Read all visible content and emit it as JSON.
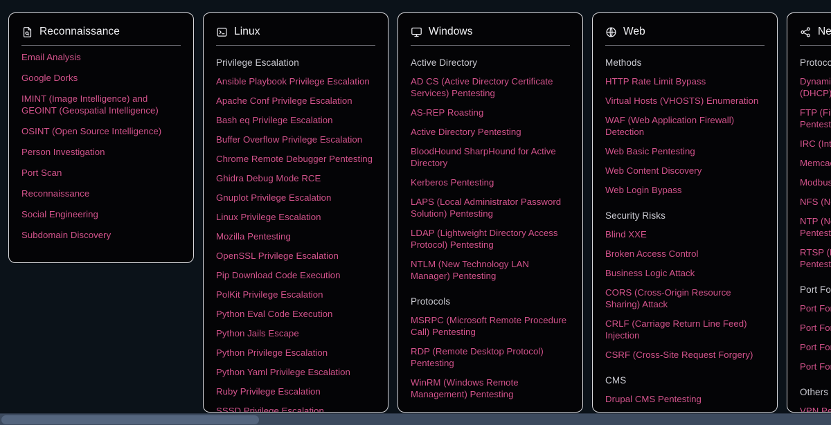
{
  "page": {
    "background_color": "#0b1219",
    "card_background_color": "#040406",
    "card_border_color": "#d8d8dc",
    "link_color": "#d3538c",
    "section_title_color": "#c9c9d0",
    "scrollbar_track_color": "#3c4a5e",
    "scrollbar_thumb_color": "#54657e"
  },
  "cards": [
    {
      "title": "Reconnaissance",
      "icon": "file-search-icon",
      "sections": [
        {
          "title": "",
          "links": [
            "Email Analysis",
            "Google Dorks",
            "IMINT (Image Intelligence) and GEOINT (Geospatial Intelligence)",
            "OSINT (Open Source Intelligence)",
            "Person Investigation",
            "Port Scan",
            "Reconnaissance",
            "Social Engineering",
            "Subdomain Discovery"
          ]
        }
      ]
    },
    {
      "title": "Linux",
      "icon": "square-terminal-icon",
      "sections": [
        {
          "title": "Privilege Escalation",
          "links": [
            "Ansible Playbook Privilege Escalation",
            "Apache Conf Privilege Escalation",
            "Bash eq Privilege Escalation",
            "Buffer Overflow Privilege Escalation",
            "Chrome Remote Debugger Pentesting",
            "Ghidra Debug Mode RCE",
            "Gnuplot Privilege Escalation",
            "Linux Privilege Escalation",
            "Mozilla Pentesting",
            "OpenSSL Privilege Escalation",
            "Pip Download Code Execution",
            "PolKit Privilege Escalation",
            "Python Eval Code Execution",
            "Python Jails Escape",
            "Python Privilege Escalation",
            "Python Yaml Privilege Escalation",
            "Ruby Privilege Escalation",
            "SSSD Privilege Escalation"
          ]
        }
      ]
    },
    {
      "title": "Windows",
      "icon": "monitor-icon",
      "sections": [
        {
          "title": "Active Directory",
          "links": [
            "AD CS (Active Directory Certificate Services) Pentesting",
            "AS-REP Roasting",
            "Active Directory Pentesting",
            "BloodHound SharpHound for Active Directory",
            "Kerberos Pentesting",
            "LAPS (Local Administrator Password Solution) Pentesting",
            "LDAP (Lightweight Directory Access Protocol) Pentesting",
            "NTLM (New Technology LAN Manager) Pentesting"
          ]
        },
        {
          "title": "Protocols",
          "links": [
            "MSRPC (Microsoft Remote Procedure Call) Pentesting",
            "RDP (Remote Desktop Protocol) Pentesting",
            "WinRM (Windows Remote Management) Pentesting"
          ]
        }
      ]
    },
    {
      "title": "Web",
      "icon": "globe-icon",
      "sections": [
        {
          "title": "Methods",
          "links": [
            "HTTP Rate Limit Bypass",
            "Virtual Hosts (VHOSTS) Enumeration",
            "WAF (Web Application Firewall) Detection",
            "Web Basic Pentesting",
            "Web Content Discovery",
            "Web Login Bypass"
          ]
        },
        {
          "title": "Security Risks",
          "links": [
            "Blind XXE",
            "Broken Access Control",
            "Business Logic Attack",
            "CORS (Cross-Origin Resource Sharing) Attack",
            "CRLF (Carriage Return Line Feed) Injection",
            "CSRF (Cross-Site Request Forgery)"
          ]
        },
        {
          "title": "CMS",
          "links": [
            "Drupal CMS Pentesting"
          ]
        }
      ]
    },
    {
      "title": "Network",
      "icon": "share-nodes-icon",
      "sections": [
        {
          "title": "Protocols",
          "links": [
            "Dynamic Host Configuration Protocol (DHCP) Pentesting",
            "FTP (File Transfer Protocol) Pentesting",
            "IRC (Internet Relay Chat) Pentesting",
            "Memcached Pentesting",
            "Modbus Pentesting",
            "NFS (Network File System) Pentesting",
            "NTP (Network Time Protocol) Pentesting",
            "RTSP (Real Time Streaming Protocol) Pentesting"
          ]
        },
        {
          "title": "Port Forwarding",
          "links": [
            "Port Forwarding with Chisel",
            "Port Forwarding with Ligolo",
            "Port Forwarding with SSH",
            "Port Forwarding with Socat"
          ]
        },
        {
          "title": "Others",
          "links": [
            "VPN Pentesting"
          ]
        }
      ]
    }
  ]
}
